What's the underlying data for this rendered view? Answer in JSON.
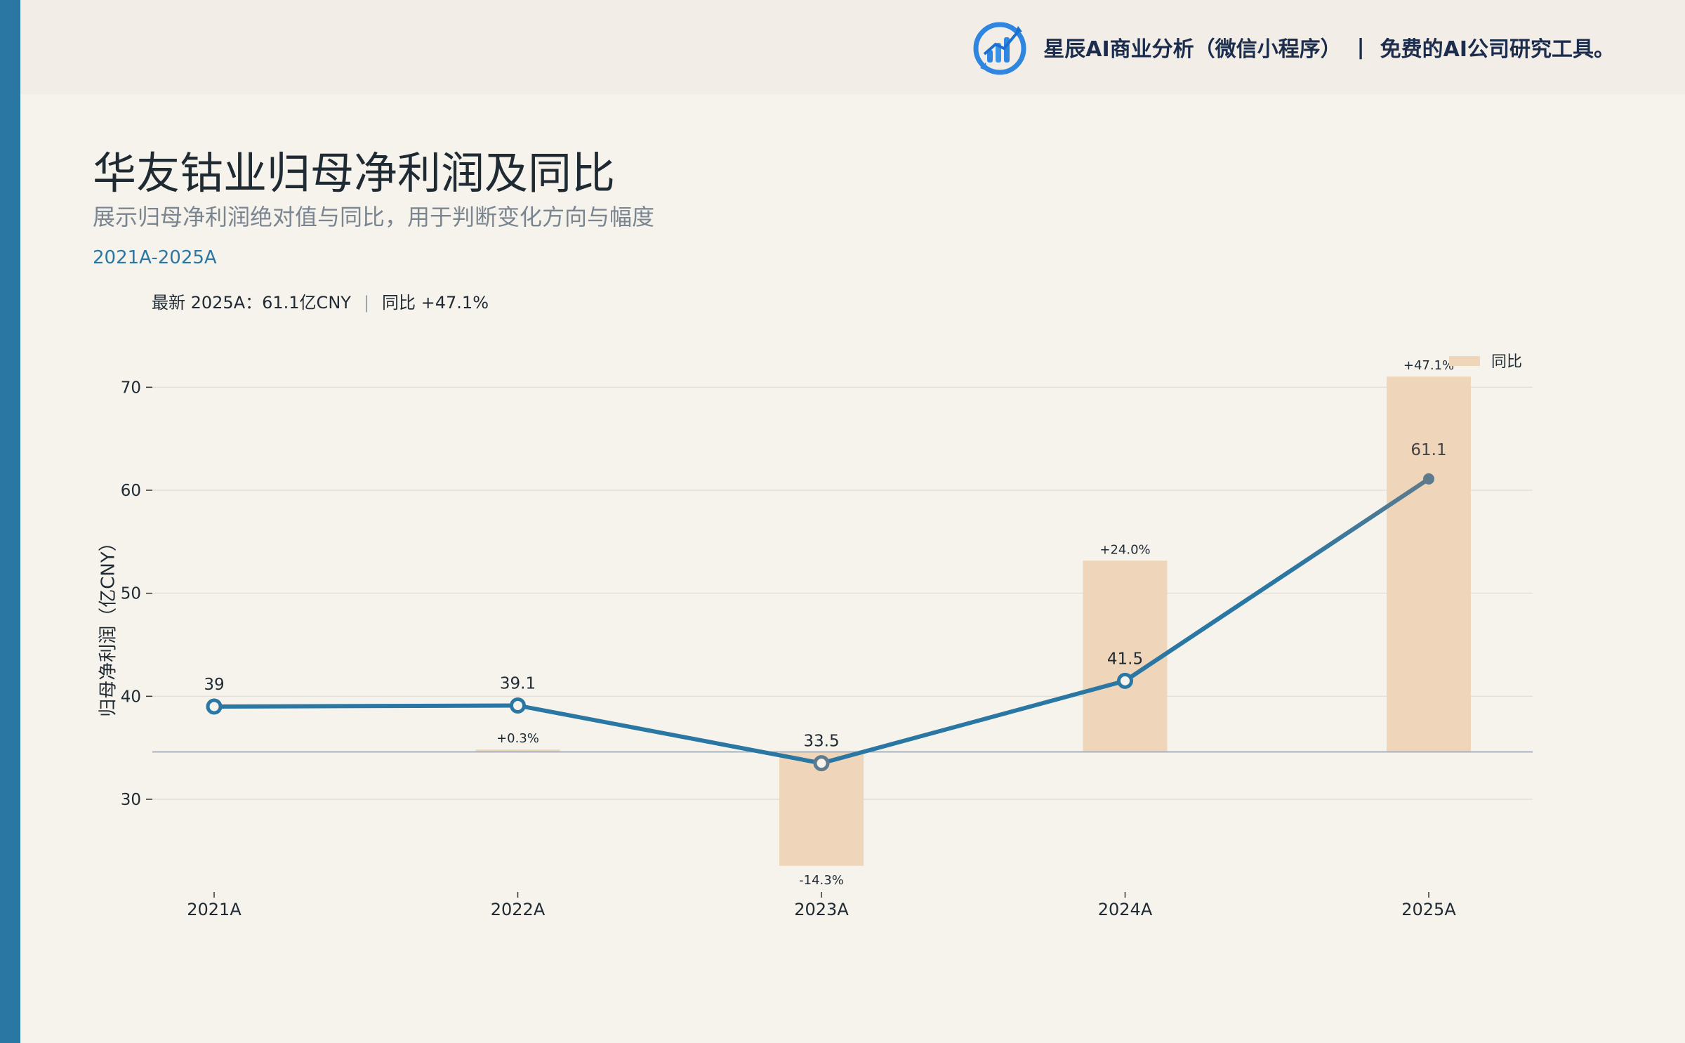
{
  "brand": {
    "name": "星辰AI商业分析（微信小程序）",
    "separator": "|",
    "slogan": "免费的AI公司研究工具。"
  },
  "header": {
    "title": "华友钴业归母净利润及同比",
    "subtitle": "展示归母净利润绝对值与同比，用于判断变化方向与幅度",
    "range": "2021A-2025A"
  },
  "summary": {
    "latest": "最新 2025A：61.1亿CNY",
    "separator": "|",
    "yoy": "同比 +47.1%"
  },
  "colors": {
    "accent": "#2a77a3",
    "bar": "#efd5b9",
    "last_segment": "#5f7a8c",
    "background": "#f6f3ed"
  },
  "chart_data": {
    "type": "line",
    "title": "华友钴业归母净利润及同比",
    "ylabel": "归母净利润（亿CNY）",
    "ylim": [
      21,
      73.5
    ],
    "yticks": [
      30,
      40,
      50,
      60,
      70
    ],
    "grid": true,
    "categories": [
      "2021A",
      "2022A",
      "2023A",
      "2024A",
      "2025A"
    ],
    "series": [
      {
        "values": [
          39,
          39.1,
          33.5,
          41.5,
          61.1
        ],
        "labels": [
          "39",
          "39.1",
          "33.5",
          "41.5",
          "61.1"
        ]
      }
    ],
    "yoy": {
      "name": "同比",
      "values": [
        null,
        0.3,
        -14.3,
        24.0,
        47.1
      ],
      "labels": [
        "",
        "+0.3%",
        "-14.3%",
        "+24.0%",
        "+47.1%"
      ],
      "baseline": 34.6,
      "scale_per_pct": 0.7735
    },
    "legend": "top-right"
  }
}
